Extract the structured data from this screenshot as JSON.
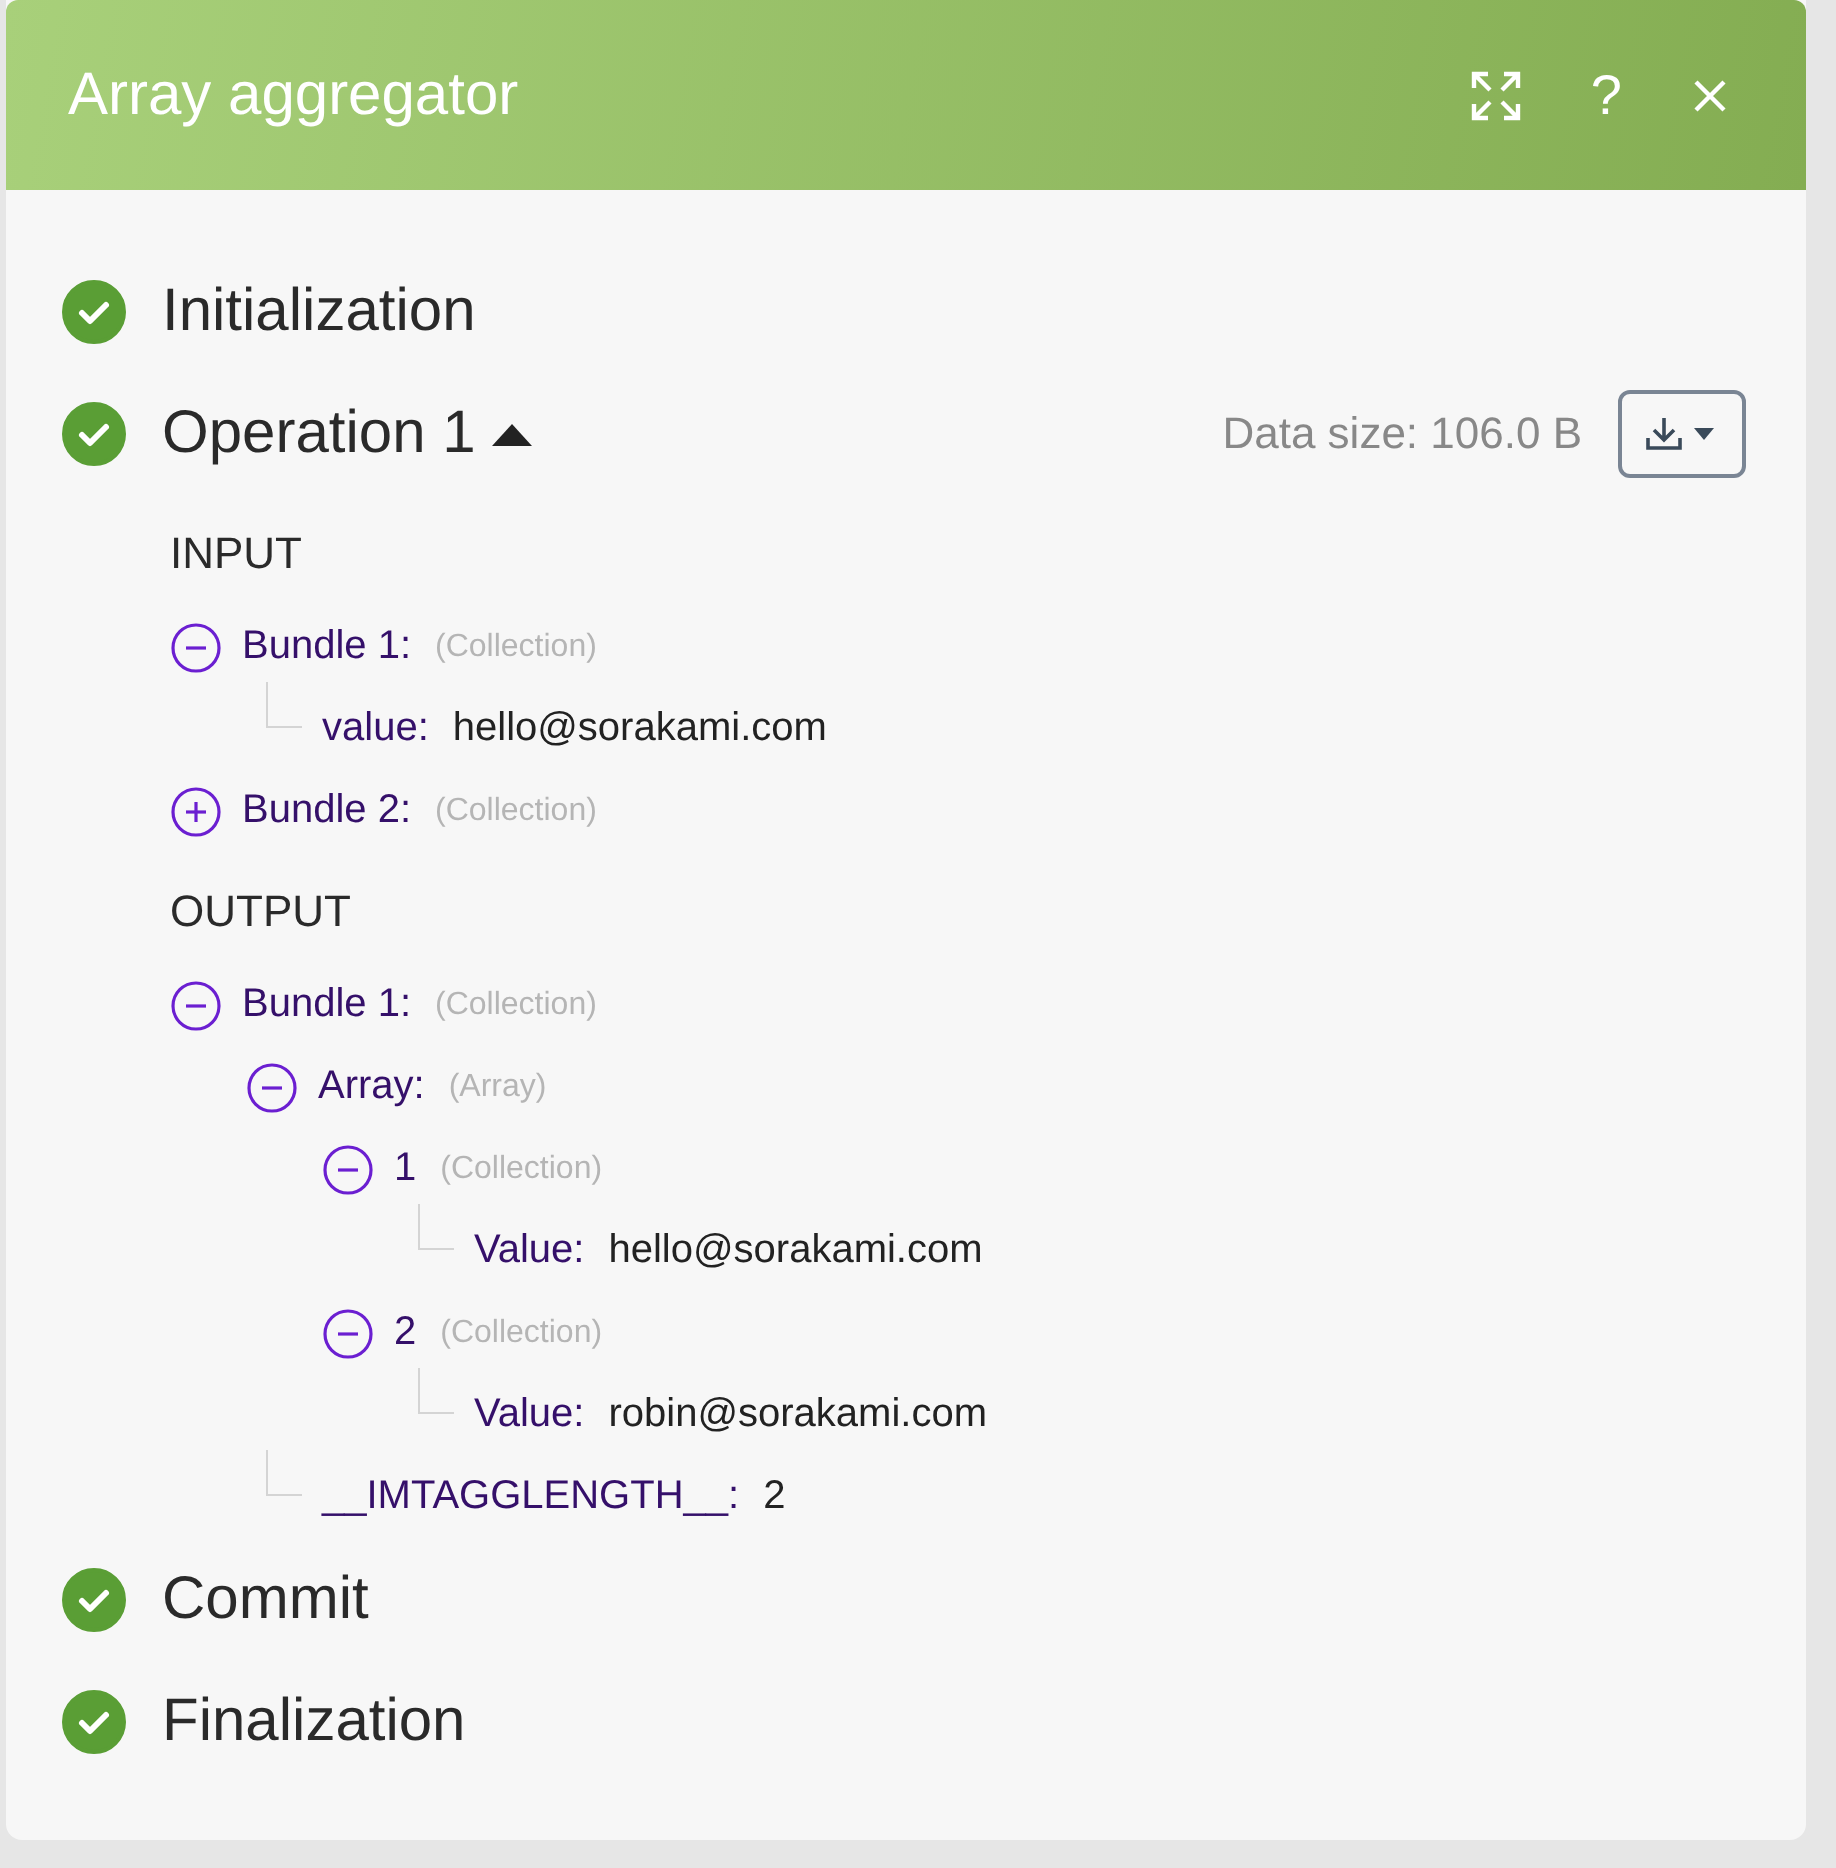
{
  "window": {
    "title": "Array aggregator",
    "help": "?"
  },
  "steps": [
    {
      "name": "Initialization",
      "done": true
    },
    {
      "name": "Operation 1",
      "done": true,
      "expanded": true,
      "data_size": "Data size: 106.0 B",
      "sections": [
        {
          "title": "INPUT",
          "tree": [
            {
              "key": "Bundle 1:",
              "type": "(Collection)",
              "expanded": true,
              "children": [
                {
                  "key": "value:",
                  "value": "hello@sorakami.com"
                }
              ]
            },
            {
              "key": "Bundle 2:",
              "type": "(Collection)",
              "expanded": false
            }
          ]
        },
        {
          "title": "OUTPUT",
          "tree": [
            {
              "key": "Bundle 1:",
              "type": "(Collection)",
              "expanded": true,
              "children": [
                {
                  "key": "Array:",
                  "type": "(Array)",
                  "expanded": true,
                  "children": [
                    {
                      "key": "1",
                      "type": "(Collection)",
                      "expanded": true,
                      "children": [
                        {
                          "key": "Value:",
                          "value": "hello@sorakami.com"
                        }
                      ]
                    },
                    {
                      "key": "2",
                      "type": "(Collection)",
                      "expanded": true,
                      "children": [
                        {
                          "key": "Value:",
                          "value": "robin@sorakami.com"
                        }
                      ]
                    }
                  ]
                },
                {
                  "key": "__IMTAGGLENGTH__:",
                  "value": "2"
                }
              ]
            }
          ]
        }
      ]
    },
    {
      "name": "Commit",
      "done": true
    },
    {
      "name": "Finalization",
      "done": true
    }
  ]
}
